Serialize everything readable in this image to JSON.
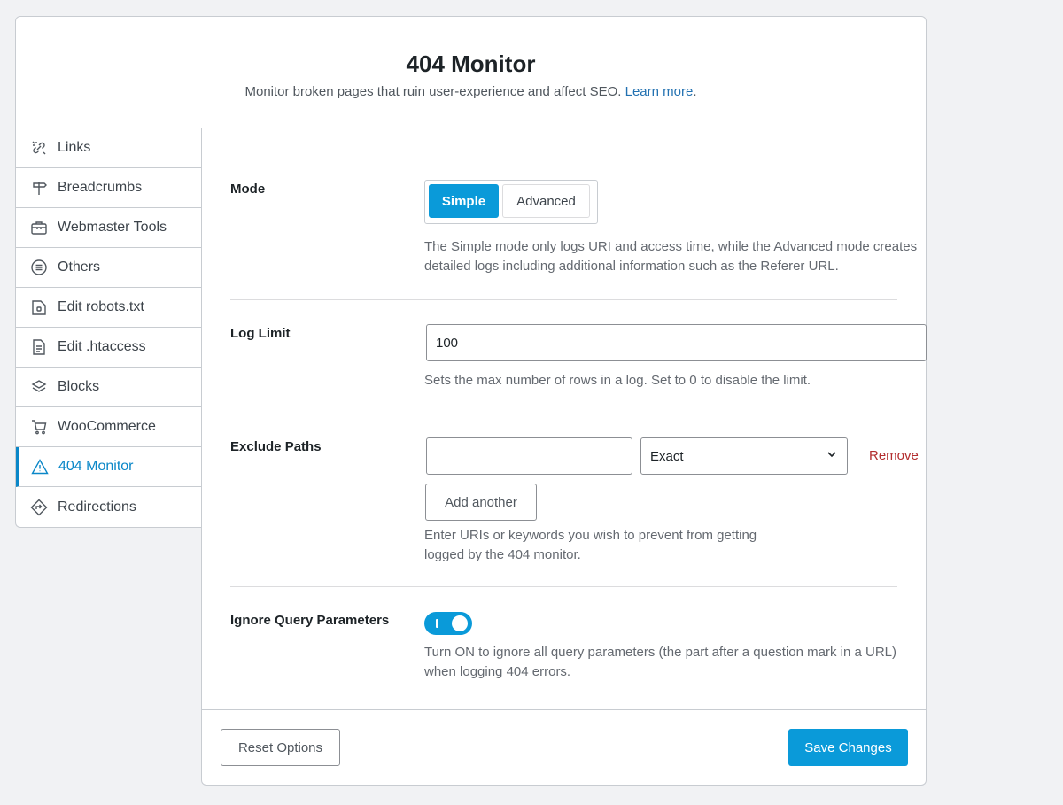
{
  "header": {
    "title": "404 Monitor",
    "subtitle": "Monitor broken pages that ruin user-experience and affect SEO.",
    "learn_more": "Learn more",
    "period": "."
  },
  "sidebar": {
    "items": [
      {
        "label": "Links",
        "icon": "links-icon"
      },
      {
        "label": "Breadcrumbs",
        "icon": "signpost-icon"
      },
      {
        "label": "Webmaster Tools",
        "icon": "toolbox-icon"
      },
      {
        "label": "Others",
        "icon": "list-circle-icon"
      },
      {
        "label": "Edit robots.txt",
        "icon": "robot-file-icon"
      },
      {
        "label": "Edit .htaccess",
        "icon": "document-icon"
      },
      {
        "label": "Blocks",
        "icon": "blocks-icon"
      },
      {
        "label": "WooCommerce",
        "icon": "cart-icon"
      },
      {
        "label": "404 Monitor",
        "icon": "warning-icon",
        "active": true
      },
      {
        "label": "Redirections",
        "icon": "redirect-icon"
      }
    ]
  },
  "settings": {
    "mode": {
      "label": "Mode",
      "options": [
        "Simple",
        "Advanced"
      ],
      "selected": "Simple",
      "help": "The Simple mode only logs URI and access time, while the Advanced mode creates detailed logs including additional information such as the Referer URL."
    },
    "log_limit": {
      "label": "Log Limit",
      "value": "100",
      "help": "Sets the max number of rows in a log. Set to 0 to disable the limit."
    },
    "exclude_paths": {
      "label": "Exclude Paths",
      "path_value": "",
      "match_type": "Exact",
      "remove_label": "Remove",
      "add_label": "Add another",
      "help": "Enter URIs or keywords you wish to prevent from getting logged by the 404 monitor."
    },
    "ignore_query": {
      "label": "Ignore Query Parameters",
      "enabled": true,
      "help": "Turn ON to ignore all query parameters (the part after a question mark in a URL) when logging 404 errors."
    }
  },
  "footer": {
    "reset_label": "Reset Options",
    "save_label": "Save Changes"
  },
  "colors": {
    "accent": "#0a9ad9",
    "remove": "#b32d2e",
    "link": "#2271b1"
  }
}
